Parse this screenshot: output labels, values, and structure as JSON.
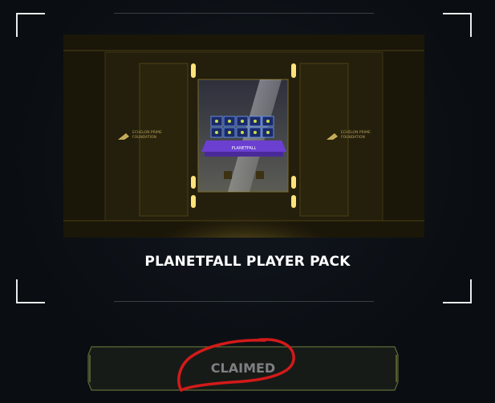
{
  "pack": {
    "title": "PLANETFALL PLAYER PACK",
    "image_left_text": "ECHELON PRIME\nFOUNDATION",
    "image_right_text": "ECHELON PRIME\nFOUNDATION",
    "image_screen_text": "PLANETFALL"
  },
  "action": {
    "label": "CLAIMED",
    "state": "claimed"
  },
  "colors": {
    "accent_gold": "#e8c24a",
    "button_border": "#6d7a3c",
    "annotation_red": "#d31a1a",
    "frame": "#e8ecef"
  }
}
